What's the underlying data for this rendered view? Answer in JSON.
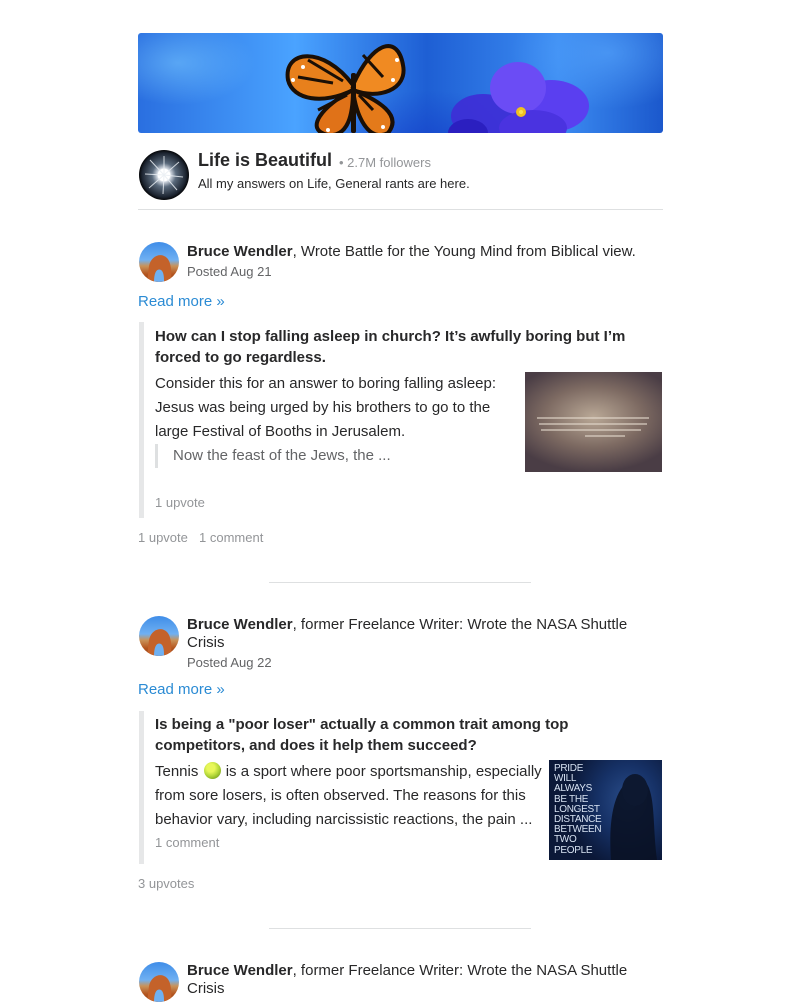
{
  "space": {
    "title": "Life is Beautiful",
    "followers": "• 2.7M followers",
    "description": "All my answers on Life, General rants are here."
  },
  "posts": [
    {
      "author": "Bruce Wendler",
      "credential": ", Wrote Battle for the Young Mind from Biblical view.",
      "posted": "Posted Aug 21",
      "read_more": "Read more »",
      "question": "How can I stop falling asleep in church? It’s awfully boring but I’m forced to go regardless.",
      "body_lines": [
        "Consider this for an answer to boring falling asleep:",
        "Jesus was being urged by his brothers to go to the",
        "large Festival of Booths in Jerusalem."
      ],
      "inner_quote": "Now the feast of the Jews, the ...",
      "inner_meta": "1 upvote",
      "stats": [
        "1 upvote",
        "1 comment"
      ]
    },
    {
      "author": "Bruce Wendler",
      "credential": ", former Freelance Writer: Wrote the NASA Shuttle Crisis",
      "posted": "Posted Aug 22",
      "read_more": "Read more »",
      "question": "Is being a \"poor loser\" actually a common trait among top competitors, and does it help them succeed?",
      "body_lines": [
        "Tennis",
        "is a sport where poor sportsmanship, especially",
        "from sore losers, is often observed. The reasons for this",
        "behavior vary, including narcissistic reactions, the pain ..."
      ],
      "inner_meta": "1 comment",
      "stats": [
        "3 upvotes"
      ],
      "image_text": [
        "PRIDE",
        "WILL",
        "ALWAYS",
        "BE THE",
        "LONGEST",
        "DISTANCE",
        "BETWEEN",
        "TWO",
        "PEOPLE"
      ]
    },
    {
      "author": "Bruce Wendler",
      "credential": ", former Freelance Writer: Wrote the NASA Shuttle Crisis"
    }
  ],
  "icons": {
    "tennis_ball": "tennis-ball-icon"
  },
  "colors": {
    "link": "#2b8bd4",
    "text": "#282829",
    "muted": "#939598",
    "divider": "#dee0e1"
  }
}
